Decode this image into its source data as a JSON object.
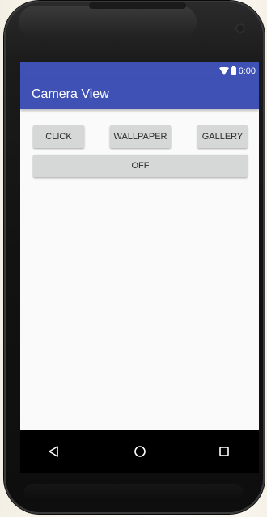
{
  "status_bar": {
    "time": "6:00",
    "icons": [
      "wifi-icon",
      "battery-icon"
    ],
    "color": "#3f51b5"
  },
  "app_bar": {
    "title": "Camera View",
    "color": "#3f51b5"
  },
  "buttons": {
    "click_label": "CLICK",
    "wallpaper_label": "WALLPAPER",
    "gallery_label": "GALLERY",
    "off_label": "OFF"
  },
  "nav_bar": {
    "icons": [
      "back-icon",
      "home-icon",
      "recents-icon"
    ]
  }
}
